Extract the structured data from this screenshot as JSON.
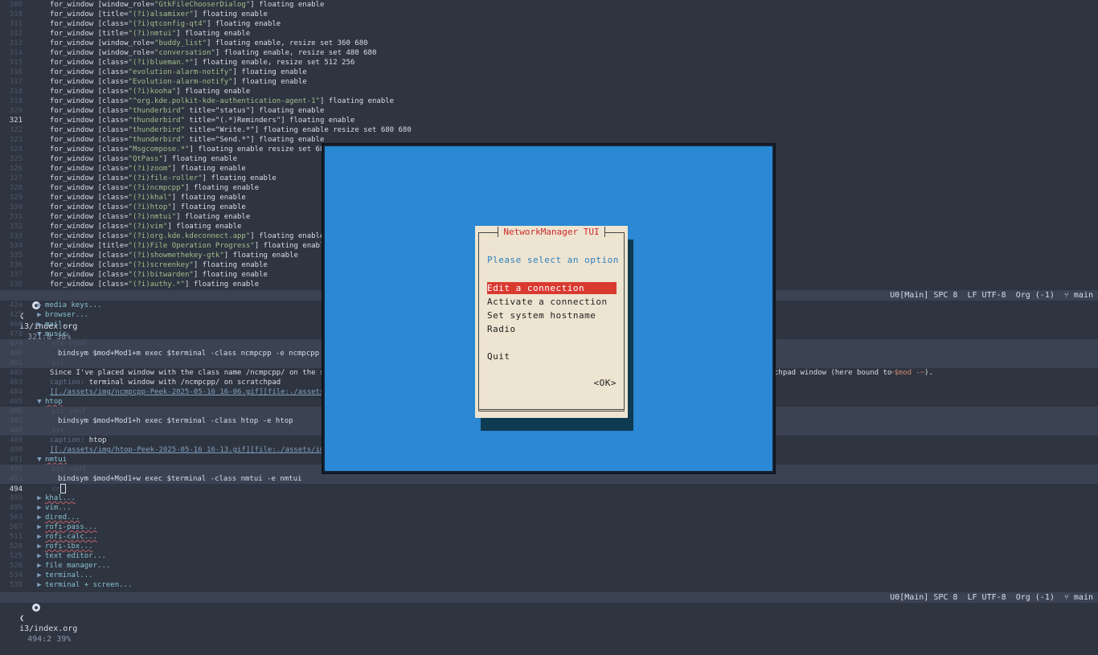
{
  "editor_top": {
    "lines": [
      {
        "n": "309",
        "pre": "for_window [window_role=",
        "s": "\"GtkFileChooserDialog\"",
        "post": "] floating enable"
      },
      {
        "n": "310",
        "pre": "for_window [title=",
        "s": "\"(?i)alsamixer\"",
        "post": "] floating enable"
      },
      {
        "n": "311",
        "pre": "for_window [class=",
        "s": "\"(?i)qtconfig-qt4\"",
        "post": "] floating enable"
      },
      {
        "n": "312",
        "pre": "for_window [title=",
        "s": "\"(?i)nmtui\"",
        "post": "] floating enable"
      },
      {
        "n": "313",
        "pre": "for_window [window_role=",
        "s": "\"buddy_list\"",
        "post": "] floating enable, resize set 360 680"
      },
      {
        "n": "314",
        "pre": "for_window [window_role=",
        "s": "\"conversation\"",
        "post": "] floating enable, resize set 480 680"
      },
      {
        "n": "315",
        "pre": "for_window [class=",
        "s": "\"(?i)blueman.*\"",
        "post": "] floating enable, resize set 512 256"
      },
      {
        "n": "316",
        "pre": "for_window [class=",
        "s": "\"evolution-alarm-notify\"",
        "post": "] floating enable"
      },
      {
        "n": "317",
        "pre": "for_window [class=",
        "s": "\"Evolution-alarm-notify\"",
        "post": "] floating enable"
      },
      {
        "n": "318",
        "pre": "for_window [class=",
        "s": "\"(?i)kooha\"",
        "post": "] floating enable"
      },
      {
        "n": "319",
        "pre": "for_window [class=",
        "s": "\"^org.kde.polkit-kde-authentication-agent-1\"",
        "post": "] floating enable"
      },
      {
        "n": "320",
        "pre": "for_window [class=",
        "s": "\"thunderbird\"",
        "post": " title=\"status\"] floating enable"
      },
      {
        "n": "321",
        "pre": "for_window [class=",
        "s": "\"thunderbird\"",
        "post": " title=\"(.*)Reminders\"] floating enable",
        "current": true
      },
      {
        "n": "322",
        "pre": "for_window [class=",
        "s": "\"thunderbird\"",
        "post": " title=\"Write.*\"] floating enable resize set 680 680"
      },
      {
        "n": "323",
        "pre": "for_window [class=",
        "s": "\"thunderbird\"",
        "post": " title=\"Send.*\"] floating enable"
      },
      {
        "n": "324",
        "pre": "for_window [class=",
        "s": "\"Msgcompose.*\"",
        "post": "] floating enable resize set 680 680"
      },
      {
        "n": "325",
        "pre": "for_window [class=",
        "s": "\"QtPass\"",
        "post": "] floating enable"
      },
      {
        "n": "326",
        "pre": "for_window [class=",
        "s": "\"(?i)zoom\"",
        "post": "] floating enable"
      },
      {
        "n": "327",
        "pre": "for_window [class=",
        "s": "\"(?i)file-roller\"",
        "post": "] floating enable"
      },
      {
        "n": "328",
        "pre": "for_window [class=",
        "s": "\"(?i)ncmpcpp\"",
        "post": "] floating enable"
      },
      {
        "n": "329",
        "pre": "for_window [class=",
        "s": "\"(?i)khal\"",
        "post": "] floating enable"
      },
      {
        "n": "330",
        "pre": "for_window [class=",
        "s": "\"(?i)htop\"",
        "post": "] floating enable"
      },
      {
        "n": "331",
        "pre": "for_window [class=",
        "s": "\"(?i)nmtui\"",
        "post": "] floating enable"
      },
      {
        "n": "332",
        "pre": "for_window [class=",
        "s": "\"(?i)vim\"",
        "post": "] floating enable"
      },
      {
        "n": "333",
        "pre": "for_window [class=",
        "s": "\"(?i)org.kde.kdeconnect.app\"",
        "post": "] floating enable"
      },
      {
        "n": "334",
        "pre": "for_window [title=",
        "s": "\"(?i)File Operation Progress\"",
        "post": "] floating enable"
      },
      {
        "n": "335",
        "pre": "for_window [class=",
        "s": "\"(?i)showmethekey-gtk\"",
        "post": "] floating enable"
      },
      {
        "n": "336",
        "pre": "for_window [class=",
        "s": "\"(?i)screenkey\"",
        "post": "] floating enable"
      },
      {
        "n": "337",
        "pre": "for_window [class=",
        "s": "\"(?i)bitwarden\"",
        "post": "] floating enable"
      },
      {
        "n": "338",
        "pre": "for_window [class=",
        "s": "\"(?i)authy.*\"",
        "post": "] floating enable"
      }
    ]
  },
  "modeline_top": {
    "file": "i3/index.org",
    "pos": "321:8 38%",
    "right": "U0[Main] SPC 8  LF UTF-8  Org (-1)  ⑂ main"
  },
  "editor_bottom": {
    "l424": {
      "n": "424",
      "text": "media keys..."
    },
    "l425": {
      "n": "425",
      "text": "browser..."
    },
    "l466": {
      "n": "466",
      "text": "mail..."
    },
    "l478": {
      "n": "478",
      "text": "music"
    },
    "l479": {
      "n": "479",
      "text": "src conf"
    },
    "l480": {
      "n": "480",
      "text": "bindsym $mod+Mod1+m exec $terminal -class ncmpcpp -e ncmpcpp"
    },
    "l481": {
      "n": "481",
      "text": "src"
    },
    "l482": {
      "n": "482",
      "text": "Since I've placed window with the class name /ncmpcpp/ on the scratchpad"
    },
    "l482b": "chpad window (here bound to ",
    "l482c": "~$mod -~",
    "l482d": ").",
    "l483k": "caption:",
    "l483": " terminal window with /ncmpcpp/ on scratchpad",
    "l484": {
      "n": "484",
      "text": "[[./assets/img/ncmpcpp-Peek-2025-05-16_16-06.gif][file:./assets/img/"
    },
    "l485": {
      "n": "485",
      "text": "htop"
    },
    "l486": {
      "n": "486",
      "text": "src conf"
    },
    "l487": {
      "n": "487",
      "text": "bindsym $mod+Mod1+h exec $terminal -class htop -e htop"
    },
    "l488": {
      "n": "488",
      "text": "src"
    },
    "l489k": "caption:",
    "l489": " htop",
    "l490": {
      "n": "490",
      "text": "[[./assets/img/htop-Peek-2025-05-16_16-13.gif][file:./assets/img/htop"
    },
    "l491": {
      "n": "491",
      "text": "nmtui"
    },
    "l492": {
      "n": "492",
      "text": "src conf"
    },
    "l493": {
      "n": "493",
      "text": "bindsym $mod+Mod1+w exec $terminal -class nmtui -e nmtui"
    },
    "l494": {
      "n": "494",
      "text": "sr"
    },
    "l495": {
      "n": "495",
      "text": "khal..."
    },
    "l499": {
      "n": "499",
      "text": "vim..."
    },
    "l503": {
      "n": "503",
      "text": "dired..."
    },
    "l507": {
      "n": "507",
      "text": "rofi-pass..."
    },
    "l511": {
      "n": "511",
      "text": "rofi-calc..."
    },
    "l520": {
      "n": "520",
      "text": "rofi-ibx..."
    },
    "l525": {
      "n": "525",
      "text": "text editor..."
    },
    "l528": {
      "n": "528",
      "text": "file manager..."
    },
    "l534": {
      "n": "534",
      "text": "terminal..."
    },
    "l538": {
      "n": "538",
      "text": "terminal + screen..."
    }
  },
  "modeline_bottom": {
    "file": "i3/index.org",
    "pos": "494:2 39%",
    "right": "U0[Main] SPC 8  LF UTF-8  Org (-1)  ⑂ main"
  },
  "nmtui": {
    "title": "NetworkManager TUI",
    "prompt": "Please select an option",
    "items": [
      "Edit a connection",
      "Activate a connection",
      "Set system hostname",
      "Radio",
      "Quit"
    ],
    "selected_index": 0,
    "ok": "<OK>"
  }
}
